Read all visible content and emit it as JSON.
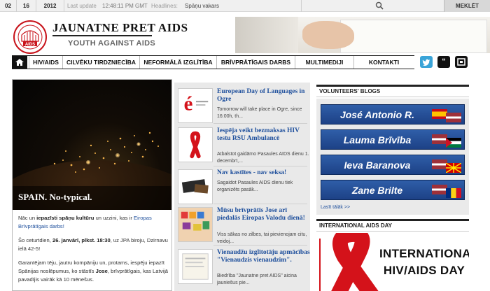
{
  "topbar": {
    "day": "02",
    "month": "16",
    "year": "2012",
    "last_update_label": "Last update",
    "last_update_time": "12:48:11 PM GMT",
    "headlines_label": "Headlines:",
    "headline": "Spāņu vakars",
    "search_button": "MEKLĒT"
  },
  "logo": {
    "title": "JAUNATNE PRET AIDS",
    "subtitle": "YOUTH AGAINST AIDS",
    "seal_text": "AIDS"
  },
  "nav": {
    "items": [
      "HIV/AIDS",
      "CILVĒKU TIRDZNIECĪBA",
      "NEFORMĀLĀ IZGLĪTĪBA",
      "BRĪVPRĀTĪGAIS DARBS",
      "MULTIMEDIJI",
      "KONTAKTI"
    ]
  },
  "feature": {
    "caption": "SPAIN. No-typical.",
    "p1_a": "Nāc un ",
    "p1_b": "iepazīsti spāņu kultūru",
    "p1_c": " un uzzini, kas ir ",
    "p1_d": "Eiropas Brīvprātīgais darbs!",
    "p2_a": "Šo ceturtdien, ",
    "p2_b": "26. janvārī, plkst. 18:30",
    "p2_c": ", uz JPA biroju, Dzirnavu ielā 42-5!",
    "p3_a": "Garantējam tēju, jautru kompāniju un, protams, iespēju iepazīt Spānijas noslēpumus, ko stāstīs ",
    "p3_b": "Jose",
    "p3_c": ", brīvprātīgais, kas Latvijā pavadījis vairāk kā 10 mēnešus."
  },
  "news": [
    {
      "title": "European Day of Languages in Ogre",
      "desc": "Tomorrow will take place in Ogre, since 16:00h, th..."
    },
    {
      "title": "Iespēja veikt bezmaksas HIV testu RSU Ambulancē",
      "desc": "Atbalstot gaidāmo Pasaules AIDS dienu 1. decembrī,..."
    },
    {
      "title": "Nav kastītes - nav seksa!",
      "desc": "Sagaidot Pasaules AIDS dienu tiek organizēts pasāk..."
    },
    {
      "title": "Mūsu brīvprātīs Jose arī piedalās Eiropas Valodu dienā!",
      "desc": "Viss sākas no zilbes, tai pievienojam citu, veidoj..."
    },
    {
      "title": "Vienaudžu izglītotāju apmācības \"Vienaudzis vienaudzim\".",
      "desc": "Biedrība \"Jaunatne pret AIDS\" aicina jauniešus pie..."
    }
  ],
  "volunteers": {
    "heading": "VOLUNTEERS' BLOGS",
    "names": [
      "José Antonio R.",
      "Lauma Brīvība",
      "Ieva Baranova",
      "Zane Brilte"
    ],
    "more": "Lasīt tālāk >>"
  },
  "aids_day": {
    "heading": "INTERNATIONAL AIDS DAY",
    "line1": "INTERNATIONAL",
    "line2": "HIV/AIDS DAY"
  },
  "colors": {
    "accent_blue": "#1e4f9c",
    "button_blue": "#2f5ea8",
    "ribbon_red": "#d4121a"
  }
}
